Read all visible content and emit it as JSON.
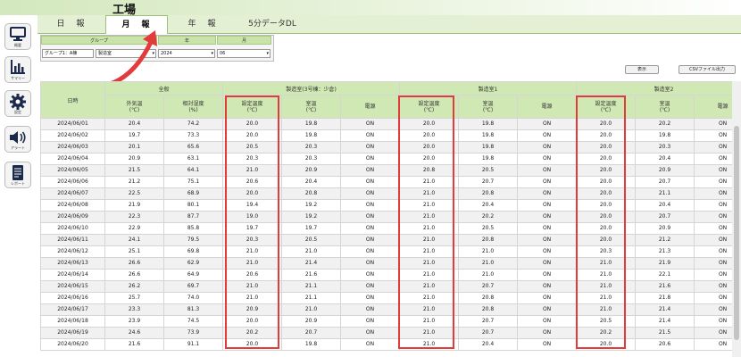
{
  "header": {
    "title": "工場"
  },
  "sidebar": [
    {
      "icon": "monitor-icon",
      "label": "概要"
    },
    {
      "icon": "bar-chart-icon",
      "label": "サマリー"
    },
    {
      "icon": "gear-icon",
      "label": "設定"
    },
    {
      "icon": "speaker-icon",
      "label": "アラート"
    },
    {
      "icon": "document-icon",
      "label": "レポート"
    }
  ],
  "tabs": [
    {
      "label": "日　報",
      "active": false
    },
    {
      "label": "月　報",
      "active": true
    },
    {
      "label": "年　報",
      "active": false
    },
    {
      "label": "5分データDL",
      "active": false
    }
  ],
  "filter": {
    "group_label": "グループ",
    "year_label": "年",
    "month_label": "月",
    "group_value_1": "グループ1：A棟",
    "group_value_2": "製造室",
    "year_value": "2024",
    "month_value": "06"
  },
  "buttons": {
    "display": "表示",
    "csv": "CSVファイル出力"
  },
  "table": {
    "date_header": "日時",
    "groups": [
      {
        "name": "全般",
        "cols": [
          "外気温\n(℃)",
          "相対湿度\n(%)"
        ]
      },
      {
        "name": "製造室(3号棟：少倉)",
        "cols": [
          "設定温度\n(℃)",
          "室温\n(℃)",
          "電源"
        ]
      },
      {
        "name": "製造室1",
        "cols": [
          "設定温度\n(℃)",
          "室温\n(℃)",
          "電源"
        ]
      },
      {
        "name": "製造室2",
        "cols": [
          "設定温度\n(℃)",
          "室温\n(℃)",
          "電源"
        ]
      }
    ],
    "rows": [
      [
        "2024/06/01",
        "20.4",
        "74.2",
        "20.0",
        "19.8",
        "ON",
        "20.0",
        "19.8",
        "ON",
        "20.0",
        "20.2",
        "ON"
      ],
      [
        "2024/06/02",
        "19.7",
        "73.3",
        "20.0",
        "19.8",
        "ON",
        "20.0",
        "19.8",
        "ON",
        "20.0",
        "19.8",
        "ON"
      ],
      [
        "2024/06/03",
        "20.1",
        "65.6",
        "20.5",
        "20.3",
        "ON",
        "20.0",
        "19.8",
        "ON",
        "20.0",
        "20.3",
        "ON"
      ],
      [
        "2024/06/04",
        "20.9",
        "63.1",
        "20.3",
        "20.3",
        "ON",
        "20.0",
        "19.8",
        "ON",
        "20.0",
        "20.4",
        "ON"
      ],
      [
        "2024/06/05",
        "21.5",
        "64.1",
        "21.0",
        "20.9",
        "ON",
        "20.8",
        "20.5",
        "ON",
        "20.0",
        "20.9",
        "ON"
      ],
      [
        "2024/06/06",
        "21.2",
        "75.1",
        "20.6",
        "20.4",
        "ON",
        "21.0",
        "20.7",
        "ON",
        "20.0",
        "20.7",
        "ON"
      ],
      [
        "2024/06/07",
        "22.5",
        "68.9",
        "20.0",
        "20.8",
        "ON",
        "21.0",
        "20.8",
        "ON",
        "20.0",
        "21.1",
        "ON"
      ],
      [
        "2024/06/08",
        "21.9",
        "80.1",
        "19.4",
        "19.2",
        "ON",
        "21.0",
        "20.4",
        "ON",
        "20.0",
        "20.4",
        "ON"
      ],
      [
        "2024/06/09",
        "22.3",
        "87.7",
        "19.0",
        "19.2",
        "ON",
        "21.0",
        "20.2",
        "ON",
        "20.0",
        "20.7",
        "ON"
      ],
      [
        "2024/06/10",
        "22.9",
        "85.8",
        "19.7",
        "19.7",
        "ON",
        "21.0",
        "20.5",
        "ON",
        "20.0",
        "20.9",
        "ON"
      ],
      [
        "2024/06/11",
        "24.1",
        "79.5",
        "20.3",
        "20.5",
        "ON",
        "21.0",
        "20.8",
        "ON",
        "20.0",
        "21.2",
        "ON"
      ],
      [
        "2024/06/12",
        "25.1",
        "69.8",
        "21.0",
        "21.0",
        "ON",
        "21.0",
        "21.0",
        "ON",
        "20.3",
        "21.3",
        "ON"
      ],
      [
        "2024/06/13",
        "26.6",
        "62.9",
        "21.0",
        "21.4",
        "ON",
        "21.0",
        "21.0",
        "ON",
        "21.0",
        "21.9",
        "ON"
      ],
      [
        "2024/06/14",
        "26.6",
        "64.9",
        "20.6",
        "21.6",
        "ON",
        "21.0",
        "21.0",
        "ON",
        "21.0",
        "22.1",
        "ON"
      ],
      [
        "2024/06/15",
        "26.2",
        "69.7",
        "21.0",
        "21.1",
        "ON",
        "21.0",
        "20.7",
        "ON",
        "21.0",
        "21.6",
        "ON"
      ],
      [
        "2024/06/16",
        "25.7",
        "74.0",
        "21.0",
        "21.1",
        "ON",
        "21.0",
        "20.8",
        "ON",
        "21.0",
        "21.8",
        "ON"
      ],
      [
        "2024/06/17",
        "23.3",
        "81.3",
        "20.9",
        "21.0",
        "ON",
        "21.0",
        "20.8",
        "ON",
        "21.0",
        "21.4",
        "ON"
      ],
      [
        "2024/06/18",
        "23.9",
        "74.5",
        "20.0",
        "20.9",
        "ON",
        "21.0",
        "20.7",
        "ON",
        "20.5",
        "21.4",
        "ON"
      ],
      [
        "2024/06/19",
        "24.6",
        "73.9",
        "20.2",
        "20.7",
        "ON",
        "21.0",
        "20.7",
        "ON",
        "20.2",
        "21.5",
        "ON"
      ],
      [
        "2024/06/20",
        "21.6",
        "91.1",
        "20.0",
        "19.8",
        "ON",
        "21.0",
        "20.4",
        "ON",
        "20.0",
        "20.6",
        "ON"
      ]
    ]
  },
  "annotation_color": "#e23b3b"
}
